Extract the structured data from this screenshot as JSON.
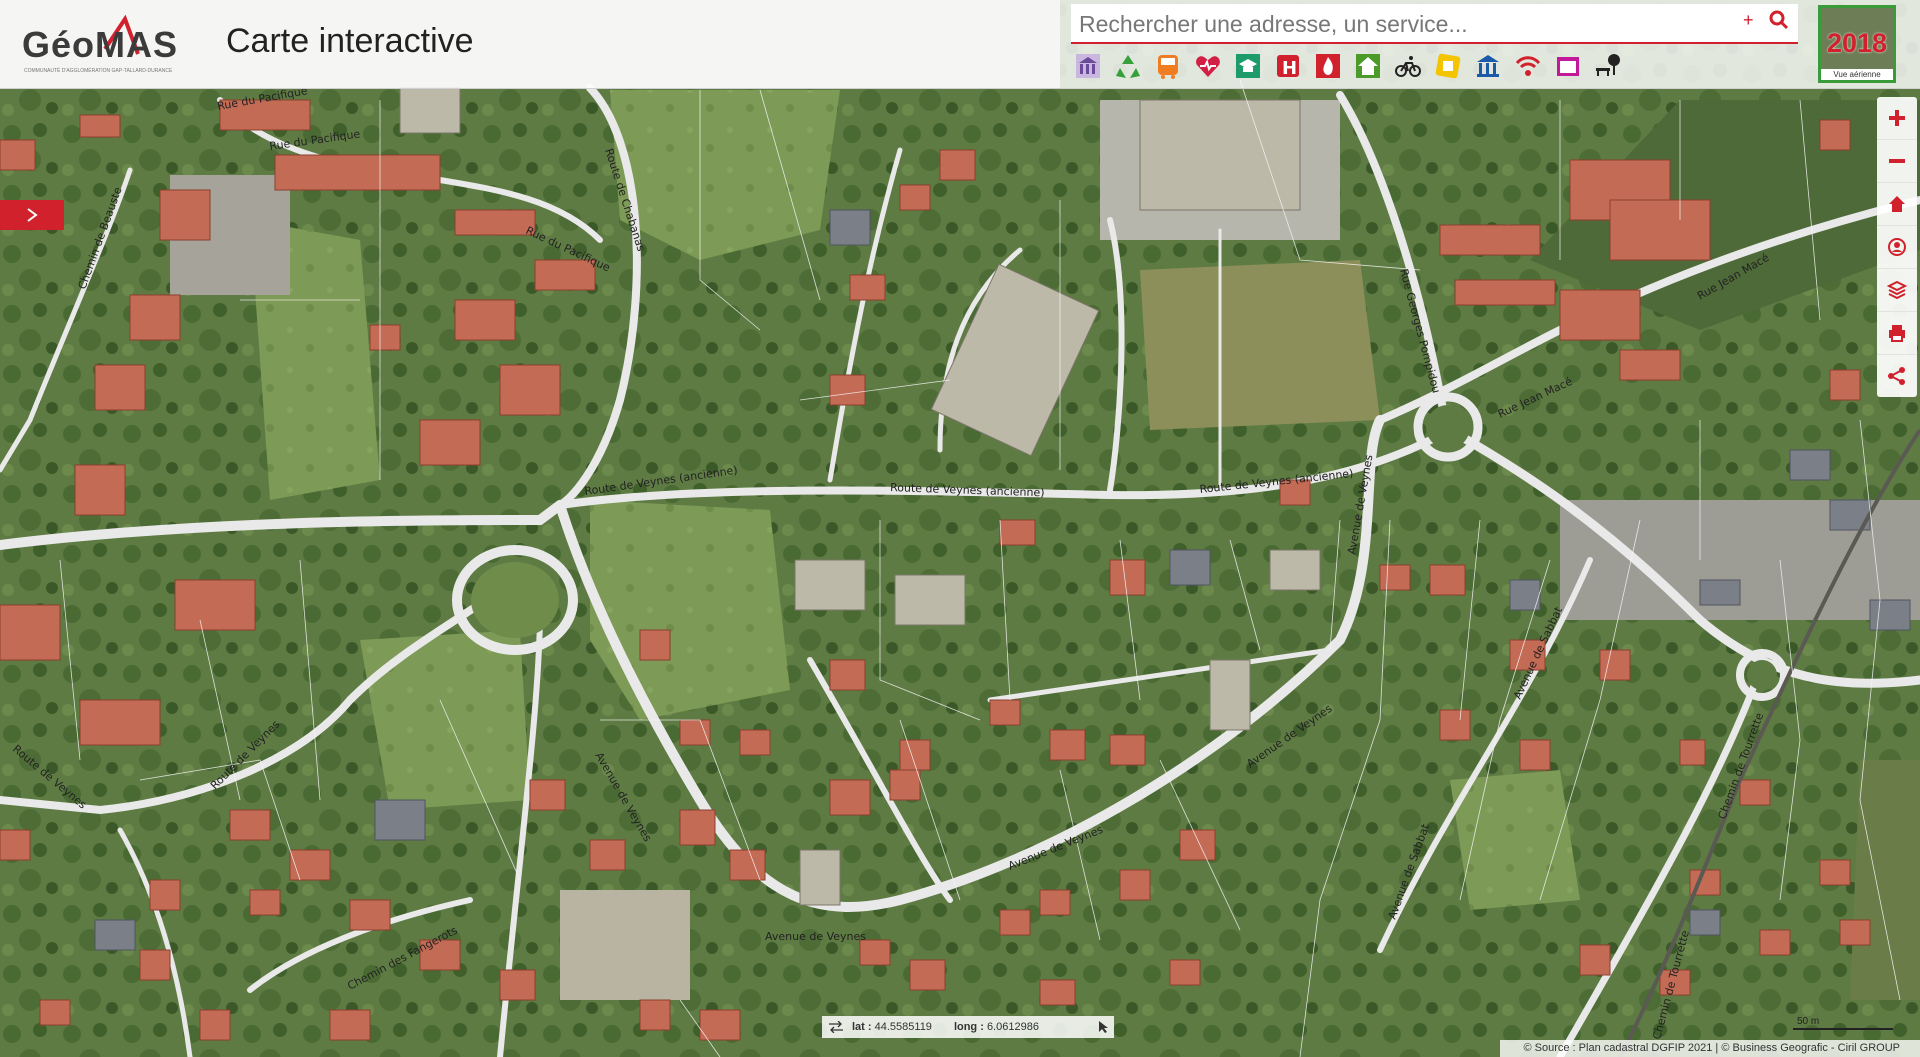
{
  "header": {
    "logo_text": "GéoMAS",
    "logo_tagline": "COMMUNAUTÉ D'AGGLOMÉRATION GAP-TALLARD-DURANCE",
    "app_title": "Carte interactive"
  },
  "search": {
    "placeholder": "Rechercher une adresse, un service...",
    "plus_label": "+"
  },
  "categories": [
    {
      "name": "administration-icon",
      "color": "#8f6fb6"
    },
    {
      "name": "recycling-icon",
      "color": "#36a03a"
    },
    {
      "name": "bus-icon",
      "color": "#f07d22"
    },
    {
      "name": "health-icon",
      "color": "#d21f44"
    },
    {
      "name": "education-icon",
      "color": "#1e9b6b"
    },
    {
      "name": "hospital-icon",
      "color": "#d0212d"
    },
    {
      "name": "fire-icon",
      "color": "#d0212d"
    },
    {
      "name": "housing-icon",
      "color": "#4c9a2a"
    },
    {
      "name": "bicycle-icon",
      "color": "#222222"
    },
    {
      "name": "culture-icon",
      "color": "#f4c400"
    },
    {
      "name": "museum-icon",
      "color": "#1b5aa8"
    },
    {
      "name": "wifi-icon",
      "color": "#d0212d"
    },
    {
      "name": "cinema-icon",
      "color": "#c2189a"
    },
    {
      "name": "park-bench-icon",
      "color": "#222222"
    }
  ],
  "aerial": {
    "year": "2018",
    "label": "Vue aérienne"
  },
  "coords": {
    "lat_label": "lat :",
    "lat_value": "44.5585119",
    "long_label": "long :",
    "long_value": "6.0612986"
  },
  "scale": {
    "label": "50 m"
  },
  "attribution": "© Source : Plan cadastral DGFIP 2021 | © Business Geografic - Ciril GROUP",
  "streets": [
    "Rue du Pacifique",
    "Rue du Pacifique",
    "Rue du Pacifique",
    "Route de Chabanas",
    "Chemin de Beauste",
    "Route de Veynes (ancienne)",
    "Route de Veynes (ancienne)",
    "Route de Veynes (ancienne)",
    "Route de Veynes",
    "Route de Veynes",
    "Avenue de Veynes",
    "Avenue de Veynes",
    "Avenue de Veynes",
    "Avenue de Veynes",
    "Avenue de Veynes",
    "Rue Georges Pompidou",
    "Rue Jean Macé",
    "Rue Jean Macé",
    "Avenue de Sabbat",
    "Avenue de Sabbat",
    "Chemin des Fangerots",
    "Chemin de Tourrette",
    "Chemin de Tourrette"
  ]
}
